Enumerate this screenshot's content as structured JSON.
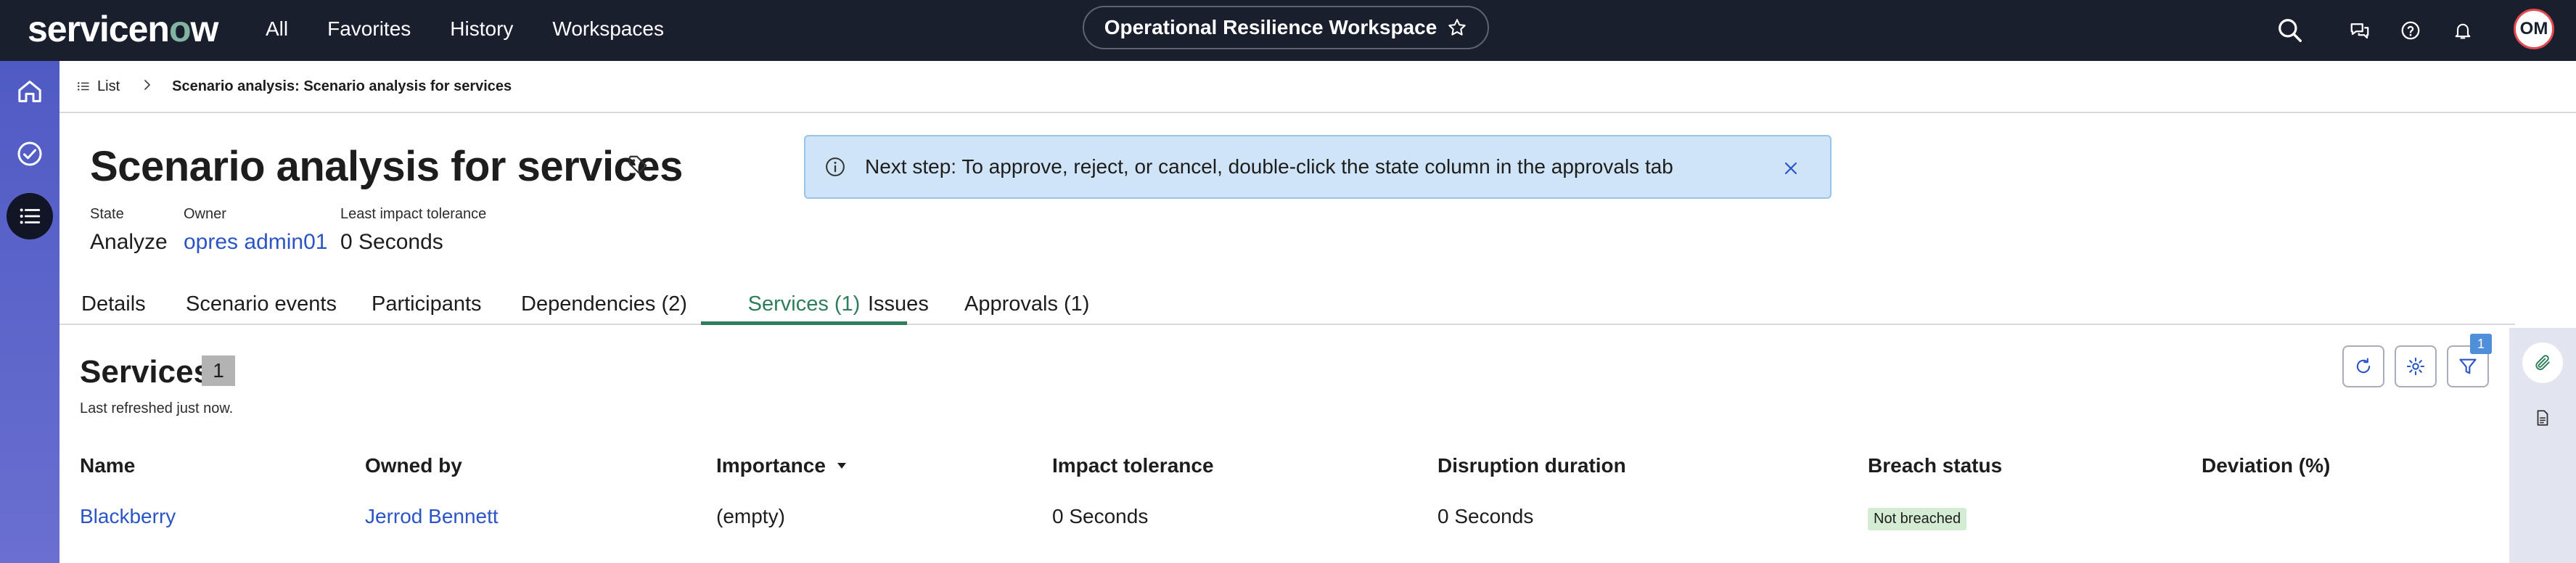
{
  "topbar": {
    "logo": "servicenow",
    "nav": [
      "All",
      "Favorites",
      "History",
      "Workspaces"
    ],
    "workspace_title": "Operational Resilience Workspace",
    "avatar_initials": "OM",
    "icons": [
      "search-icon",
      "chat-icon",
      "help-icon",
      "bell-icon"
    ]
  },
  "breadcrumb": {
    "list_label": "List",
    "current": "Scenario analysis: Scenario analysis for services"
  },
  "record": {
    "title": "Scenario analysis for services",
    "fields": [
      {
        "label": "State",
        "value": "Analyze"
      },
      {
        "label": "Owner",
        "value": "opres admin01"
      },
      {
        "label": "Least impact tolerance",
        "value": "0 Seconds"
      }
    ]
  },
  "banner": {
    "message": "Next step: To approve, reject, or cancel, double-click the state column in the approvals tab"
  },
  "tabs": [
    "Details",
    "Scenario events",
    "Participants",
    "Dependencies (2)",
    "Services (1)",
    "Issues",
    "Approvals (1)"
  ],
  "active_tab": "Services (1)",
  "services": {
    "title": "Services",
    "count": "1",
    "refreshed": "Last refreshed just now.",
    "filter_count": "1",
    "columns": [
      "Name",
      "Owned by",
      "Importance",
      "Impact tolerance",
      "Disruption duration",
      "Breach status",
      "Deviation (%)"
    ],
    "rows": [
      {
        "name": "Blackberry",
        "owned_by": "Jerrod Bennett",
        "importance": "(empty)",
        "impact_tolerance": "0 Seconds",
        "disruption_duration": "0 Seconds",
        "breach_status": "Not breached",
        "deviation": ""
      }
    ]
  },
  "colors": {
    "topbar": "#1a1f2e",
    "rail": "#5a63c9",
    "link": "#2b55c5",
    "active_tab": "#2e7d5b",
    "banner_bg": "#cfe4f6",
    "status_ok_bg": "#d4ecd4"
  }
}
